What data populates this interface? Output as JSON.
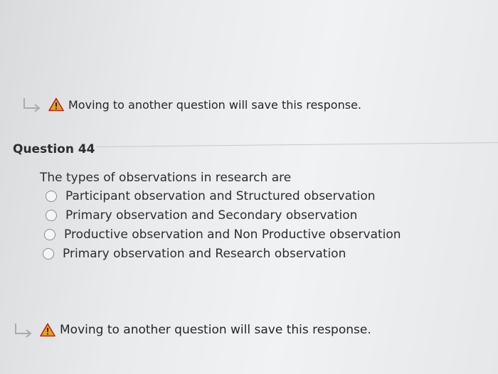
{
  "top_notice": {
    "text": "Moving to another question will save this response."
  },
  "question": {
    "title": "Question 44",
    "text": "The types of observations in research are",
    "options": [
      {
        "label": "Participant observation and Structured observation",
        "selected": false
      },
      {
        "label": "Primary observation and Secondary observation",
        "selected": false
      },
      {
        "label": "Productive observation and Non Productive observation",
        "selected": false
      },
      {
        "label": "Primary observation and Research observation",
        "selected": false
      }
    ]
  },
  "bottom_notice": {
    "text": "Moving to another question will save this response."
  },
  "colors": {
    "warning_fill": "#e8a21a",
    "warning_border": "#b5261e",
    "arrow": "#a9abae"
  }
}
